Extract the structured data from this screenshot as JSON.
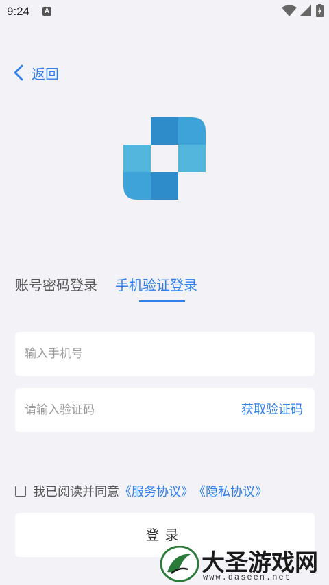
{
  "status_bar": {
    "time": "9:24",
    "notification_icon": "A"
  },
  "header": {
    "back_label": "返回"
  },
  "tabs": {
    "password_login": "账号密码登录",
    "sms_login": "手机验证登录",
    "active": "sms_login"
  },
  "form": {
    "phone_placeholder": "输入手机号",
    "code_placeholder": "请输入验证码",
    "get_code_label": "获取验证码"
  },
  "agreement": {
    "prefix": "我已阅读并同意",
    "service_link": "《服务协议》",
    "privacy_link": "《隐私协议》",
    "checked": false
  },
  "login_button": {
    "label": "登录"
  },
  "watermark": {
    "title": "大圣游戏网",
    "url": "www.daseen.net"
  },
  "colors": {
    "accent": "#2f80ed",
    "background": "#f3f2f7",
    "logo_dark": "#2e8ccb",
    "logo_light": "#52b6dd"
  }
}
